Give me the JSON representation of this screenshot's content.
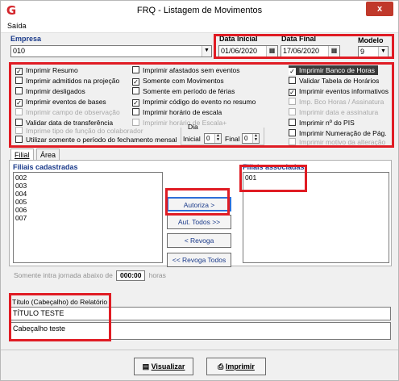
{
  "window": {
    "title": "FRQ - Listagem de Movimentos",
    "close_label": "x",
    "app_icon": "G"
  },
  "menu": {
    "items": [
      "Saída"
    ]
  },
  "empresa": {
    "label": "Empresa",
    "value": "010"
  },
  "data_inicial": {
    "label": "Data Inicial",
    "value": "01/06/2020"
  },
  "data_final": {
    "label": "Data Final",
    "value": "17/06/2020"
  },
  "modelo": {
    "label": "Modelo",
    "value": "9"
  },
  "options": {
    "col1": [
      {
        "label": "Imprimir Resumo",
        "checked": true,
        "enabled": true
      },
      {
        "label": "Imprimir admitidos na projeção",
        "checked": false,
        "enabled": true
      },
      {
        "label": "Imprimir desligados",
        "checked": false,
        "enabled": true
      },
      {
        "label": "Imprimir eventos de bases",
        "checked": true,
        "enabled": true
      },
      {
        "label": "Imprimir campo de observação",
        "checked": false,
        "enabled": false
      },
      {
        "label": "Validar data de transferência",
        "checked": false,
        "enabled": true
      },
      {
        "label": "Imprime tipo de função do colaborador",
        "checked": false,
        "enabled": false
      },
      {
        "label": "Utilizar somente o período do fechamento mensal",
        "checked": false,
        "enabled": true
      }
    ],
    "col2": [
      {
        "label": "Imprimir afastados sem eventos",
        "checked": false,
        "enabled": true
      },
      {
        "label": "Somente com Movimentos",
        "checked": true,
        "enabled": true
      },
      {
        "label": "Somente em período de férias",
        "checked": false,
        "enabled": true
      },
      {
        "label": "Imprimir código do evento no resumo",
        "checked": true,
        "enabled": true
      },
      {
        "label": "Imprimir horário de escala",
        "checked": false,
        "enabled": true
      },
      {
        "label": "Imprimir horário de Escala+",
        "checked": false,
        "enabled": false
      }
    ],
    "col3": [
      {
        "label": "Imprimir Banco de Horas",
        "checked": true,
        "enabled": true,
        "highlight": true
      },
      {
        "label": "Validar Tabela de Horários",
        "checked": false,
        "enabled": true
      },
      {
        "label": "Imprimir eventos informativos",
        "checked": true,
        "enabled": true
      },
      {
        "label": "Imp. Bco Horas / Assinatura",
        "checked": false,
        "enabled": false
      },
      {
        "label": "Imprimir data e assinatura",
        "checked": false,
        "enabled": false
      },
      {
        "label": "Imprimir nº do PIS",
        "checked": false,
        "enabled": true
      },
      {
        "label": "Imprimir Numeração de Pág.",
        "checked": false,
        "enabled": true
      },
      {
        "label": "Imprimir motivo da alteração",
        "checked": false,
        "enabled": false
      }
    ],
    "dia": {
      "label": "Dia",
      "inicial_label": "Inicial",
      "inicial_value": "0",
      "final_label": "Final",
      "final_value": "0"
    }
  },
  "tabs": [
    {
      "label": "Filial",
      "active": true
    },
    {
      "label": "Área",
      "active": false
    }
  ],
  "filiais": {
    "cadastradas_label": "Filiais cadastradas",
    "cadastradas": [
      "002",
      "003",
      "004",
      "005",
      "006",
      "007"
    ],
    "associadas_label": "Filiais associadas",
    "associadas": [
      "001"
    ]
  },
  "buttons": {
    "autoriza": "Autoriza >",
    "aut_todos": "Aut. Todos >>",
    "revoga": "< Revoga",
    "revoga_todos": "<< Revoga Todos",
    "visualizar": "Visualizar",
    "imprimir": "Imprimir"
  },
  "intrajornada": {
    "prefix": "Somente intra jornada abaixo de",
    "value": "000:00",
    "suffix": "horas"
  },
  "titulo": {
    "label": "Título (Cabeçalho) do Relatório",
    "line1": "TÍTULO TESTE",
    "line2": "Cabeçalho teste"
  },
  "colors": {
    "highlight_red": "#e01c24",
    "label_blue": "#1a3a8a",
    "close_red": "#c0392b"
  }
}
